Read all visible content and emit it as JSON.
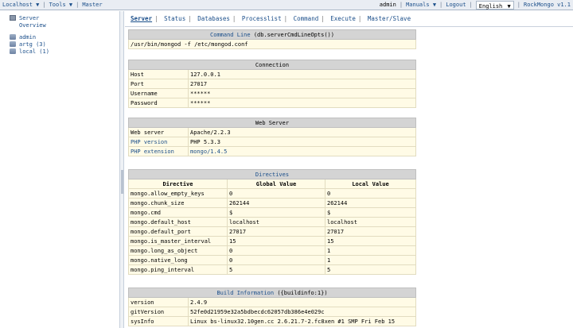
{
  "topbar": {
    "server": "Localhost",
    "tools": "Tools",
    "master": "Master",
    "user": "admin",
    "manuals": "Manuals",
    "logout": "Logout",
    "language": "English",
    "brand": "RockMongo v1.1"
  },
  "sidebar": {
    "server": "Server",
    "overview": "Overview",
    "dbs": [
      "admin",
      "artg (3)",
      "local (1)"
    ]
  },
  "nav": [
    "Server",
    "Status",
    "Databases",
    "Processlist",
    "Command",
    "Execute",
    "Master/Slave"
  ],
  "cmdline": {
    "title_link": "Command Line",
    "title_rest": "(db.serverCmdLineOpts())",
    "value": "/usr/bin/mongod -f /etc/mongod.conf"
  },
  "connection": {
    "title": "Connection",
    "rows": [
      [
        "Host",
        "127.0.0.1"
      ],
      [
        "Port",
        "27017"
      ],
      [
        "Username",
        "******"
      ],
      [
        "Password",
        "******"
      ]
    ]
  },
  "webserver": {
    "title": "Web Server",
    "rows": [
      [
        "Web server",
        "Apache/2.2.3"
      ],
      [
        "PHP version",
        "PHP 5.3.3"
      ],
      [
        "PHP extension",
        "mongo/1.4.5"
      ]
    ]
  },
  "directives": {
    "title": "Directives",
    "headers": [
      "Directive",
      "Global Value",
      "Local Value"
    ],
    "rows": [
      [
        "mongo.allow_empty_keys",
        "0",
        "0"
      ],
      [
        "mongo.chunk_size",
        "262144",
        "262144"
      ],
      [
        "mongo.cmd",
        "$",
        "$"
      ],
      [
        "mongo.default_host",
        "localhost",
        "localhost"
      ],
      [
        "mongo.default_port",
        "27017",
        "27017"
      ],
      [
        "mongo.is_master_interval",
        "15",
        "15"
      ],
      [
        "mongo.long_as_object",
        "0",
        "1"
      ],
      [
        "mongo.native_long",
        "0",
        "1"
      ],
      [
        "mongo.ping_interval",
        "5",
        "5"
      ]
    ]
  },
  "build": {
    "title_link": "Build Information",
    "title_rest": "({buildinfo:1})",
    "rows": [
      [
        "version",
        "2.4.9"
      ],
      [
        "gitVersion",
        "52fe0d21959e32a5bdbecdc62057db386e4e029c"
      ],
      [
        "sysInfo",
        "Linux bs-linux32.10gen.cc 2.6.21.7-2.fc8xen #1 SMP Fri Feb 15"
      ]
    ]
  }
}
